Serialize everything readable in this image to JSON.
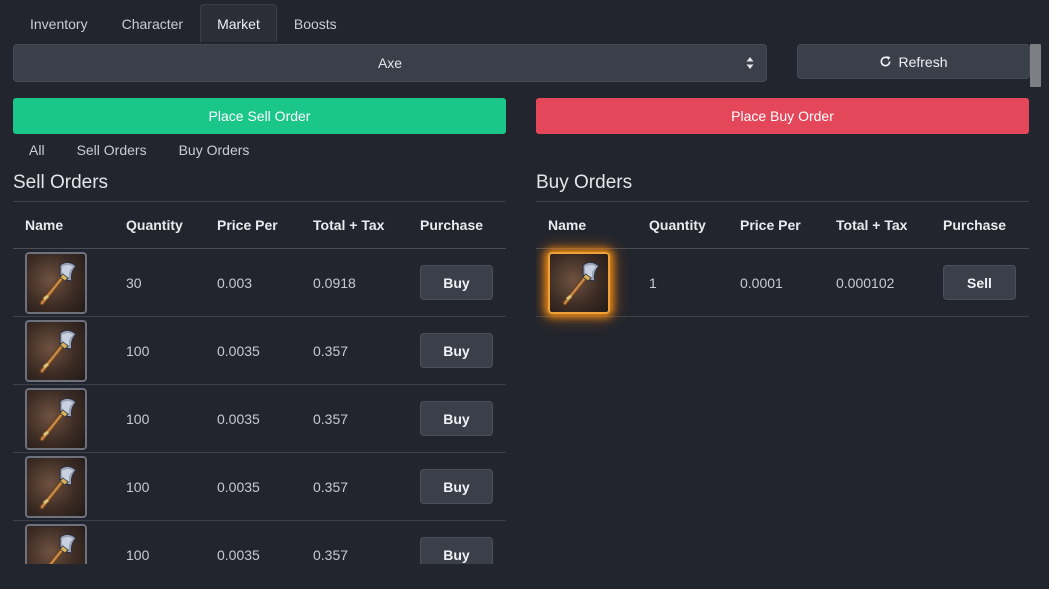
{
  "tabs": [
    {
      "label": "Inventory",
      "active": false
    },
    {
      "label": "Character",
      "active": false
    },
    {
      "label": "Market",
      "active": true
    },
    {
      "label": "Boosts",
      "active": false
    }
  ],
  "item_select": {
    "value": "Axe"
  },
  "refresh": {
    "label": "Refresh",
    "icon": "refresh-icon"
  },
  "place_sell_order": {
    "label": "Place Sell Order",
    "color": "#1bc68b"
  },
  "place_buy_order": {
    "label": "Place Buy Order",
    "color": "#e4465a"
  },
  "filters": [
    "All",
    "Sell Orders",
    "Buy Orders"
  ],
  "sell_orders": {
    "title": "Sell Orders",
    "columns": [
      "Name",
      "Quantity",
      "Price Per",
      "Total + Tax",
      "Purchase"
    ],
    "rows": [
      {
        "icon": "axe-icon",
        "quantity": "30",
        "price_per": "0.003",
        "total_tax": "0.0918",
        "action": "Buy"
      },
      {
        "icon": "axe-icon",
        "quantity": "100",
        "price_per": "0.0035",
        "total_tax": "0.357",
        "action": "Buy"
      },
      {
        "icon": "axe-icon",
        "quantity": "100",
        "price_per": "0.0035",
        "total_tax": "0.357",
        "action": "Buy"
      },
      {
        "icon": "axe-icon",
        "quantity": "100",
        "price_per": "0.0035",
        "total_tax": "0.357",
        "action": "Buy"
      },
      {
        "icon": "axe-icon",
        "quantity": "100",
        "price_per": "0.0035",
        "total_tax": "0.357",
        "action": "Buy"
      }
    ]
  },
  "buy_orders": {
    "title": "Buy Orders",
    "columns": [
      "Name",
      "Quantity",
      "Price Per",
      "Total + Tax",
      "Purchase"
    ],
    "rows": [
      {
        "icon": "axe-icon",
        "quantity": "1",
        "price_per": "0.0001",
        "total_tax": "0.000102",
        "action": "Sell",
        "highlighted": true
      }
    ]
  }
}
